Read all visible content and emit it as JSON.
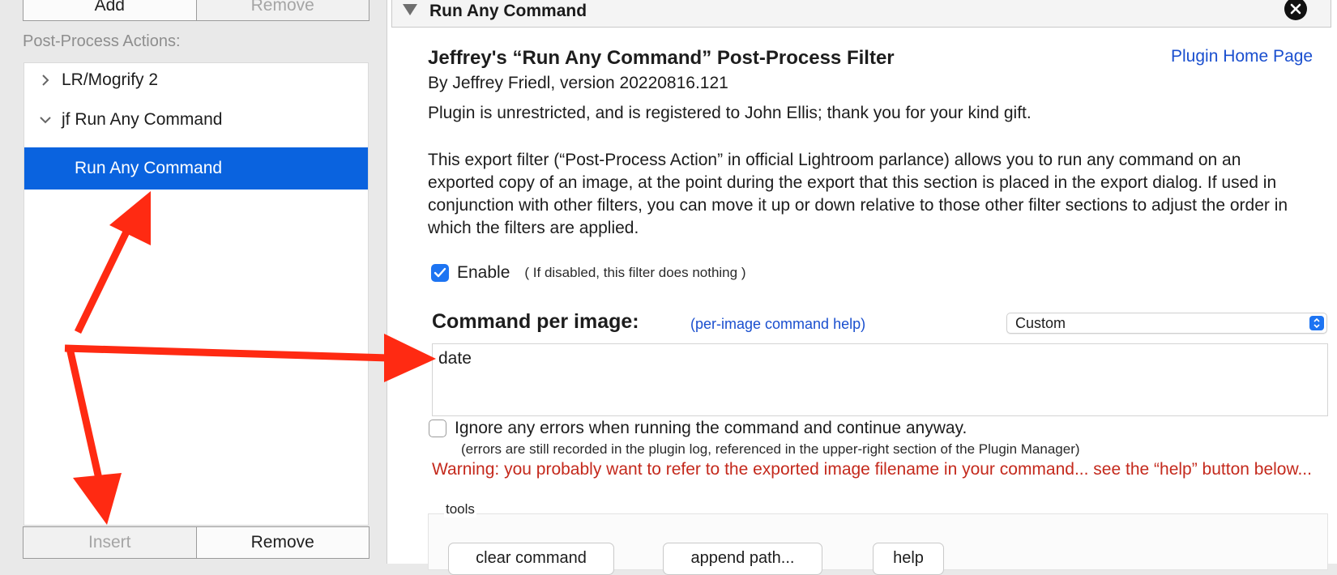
{
  "left_panel": {
    "top_buttons": {
      "add": "Add",
      "remove": "Remove"
    },
    "actions_label": "Post-Process Actions:",
    "tree": [
      {
        "label": "LR/Mogrify 2",
        "state": "collapsed"
      },
      {
        "label": "jf Run Any Command",
        "state": "expanded"
      },
      {
        "label": "Run Any Command",
        "state": "selected"
      }
    ],
    "bottom_buttons": {
      "insert": "Insert",
      "remove": "Remove"
    }
  },
  "section": {
    "header_title": "Run Any Command",
    "plugin_title": "Jeffrey's “Run Any Command” Post-Process Filter",
    "home_link": "Plugin Home Page",
    "byline": "By Jeffrey Friedl, version 20220816.121",
    "registration": "Plugin is unrestricted, and is registered to John Ellis; thank you for your kind gift.",
    "description": "This export filter (“Post-Process Action” in official Lightroom parlance) allows you to run any command on an exported copy of an image, at the point during the export that this section is placed in the export dialog. If used in conjunction with other filters, you can move it up or down relative to those other filter sections to adjust the order in which the filters are applied.",
    "enable": {
      "label": "Enable",
      "note": "( If disabled, this filter does nothing )",
      "checked": true
    },
    "command": {
      "label": "Command per image:",
      "help_link": "(per-image command help)",
      "preset_selected": "Custom",
      "value": "date"
    },
    "ignore_errors": {
      "label": "Ignore any errors when running the command and continue anyway.",
      "note": "(errors are still recorded in the plugin log, referenced in the upper-right section of the Plugin Manager)",
      "checked": false
    },
    "warning": "Warning: you probably want to refer to the exported image filename in your command... see the “help” button below...",
    "tools": {
      "label": "tools",
      "buttons": [
        "clear command",
        "append path...",
        "help"
      ]
    }
  },
  "colors": {
    "selection": "#0a63df",
    "link": "#1a4fcf",
    "warning": "#c4291c",
    "annotation_arrow": "#ff2a12"
  }
}
